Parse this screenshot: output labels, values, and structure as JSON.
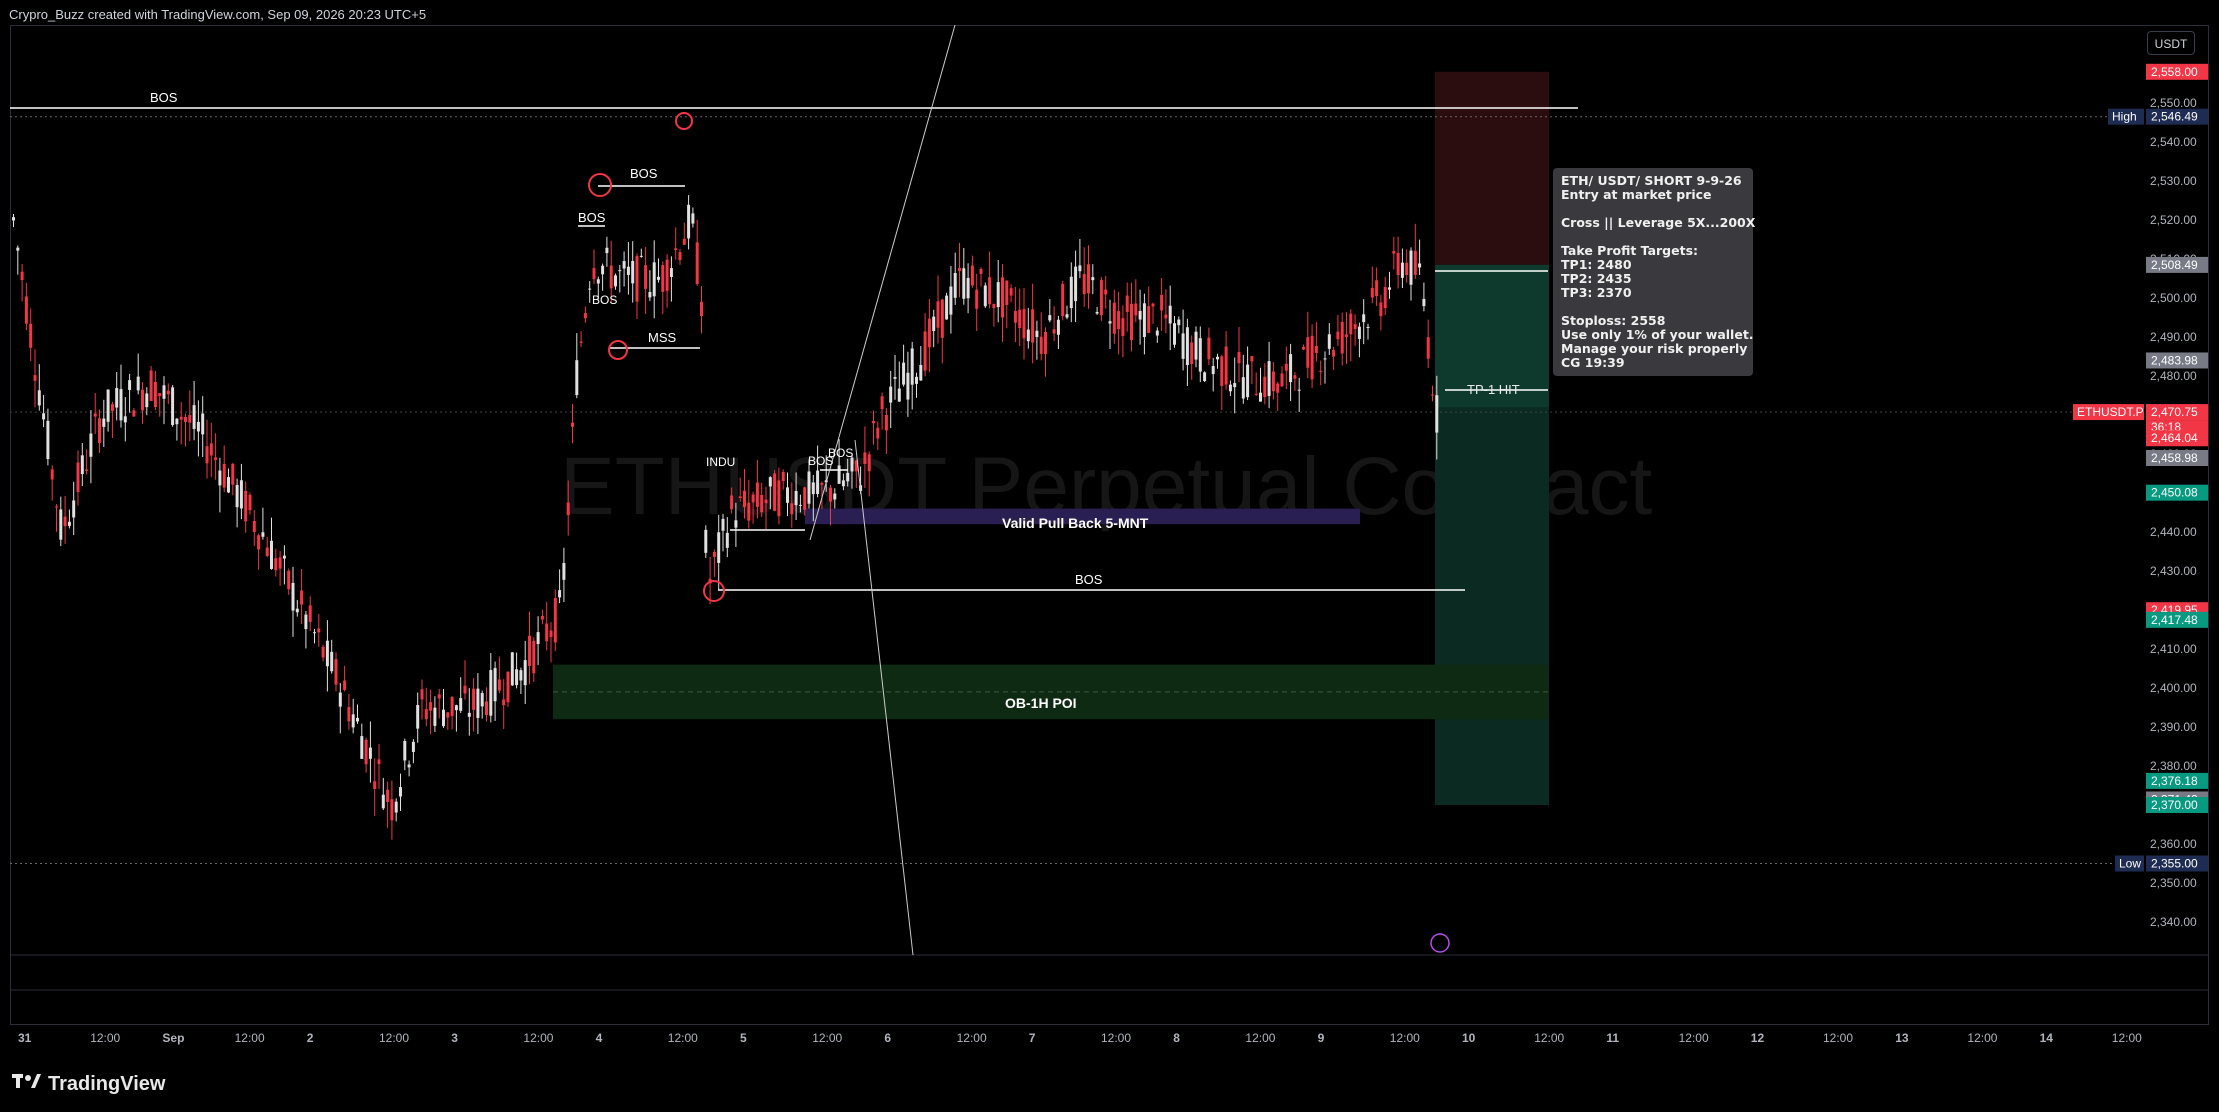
{
  "header": {
    "attribution": "Crypro_Buzz created with TradingView.com, Sep 09, 2026 20:23 UTC+5"
  },
  "watermark": "ETHUSDT Perpetual Contract",
  "currency_button": "USDT",
  "footer": {
    "brand": "TradingView"
  },
  "trade_note": {
    "lines": [
      "ETH/ USDT/ SHORT 9-9-26",
      "Entry at market price",
      "",
      "Cross || Leverage 5X...200X",
      "",
      "Take Profit Targets:",
      "TP1: 2480",
      "TP2: 2435",
      "TP3: 2370",
      "",
      "Stoploss: 2558",
      "Use only 1% of your wallet.",
      "Manage your risk properly",
      "CG 19:39"
    ]
  },
  "annotations": {
    "bos_top": "BOS",
    "bos_2": "BOS",
    "bos_3": "BOS",
    "bos_4": "BOS",
    "mss": "MSS",
    "indu": "INDU",
    "bos_5": "BOS",
    "bos_6": "BOS",
    "pullback": "Valid Pull Back 5-MNT",
    "bos_low": "BOS",
    "ob_poi": "OB-1H POI",
    "tp_hit": "TP-1 HIT"
  },
  "colors": {
    "up": "#e0e0e0",
    "down": "#f23645",
    "green": "#089981",
    "red_zone": "#2b0d10",
    "green_zone": "#0a2a22",
    "ob_zone": "#0f2a12",
    "pullback_zone": "#2a1f52",
    "navy_chip": "#1e2b52"
  },
  "price_axis": {
    "ticks": [
      "2,550.00",
      "2,540.00",
      "2,530.00",
      "2,520.00",
      "2,510.00",
      "2,500.00",
      "2,490.00",
      "2,480.00",
      "2,470.00",
      "2,460.00",
      "2,450.00",
      "2,440.00",
      "2,430.00",
      "2,420.00",
      "2,410.00",
      "2,400.00",
      "2,390.00",
      "2,380.00",
      "2,370.00",
      "2,360.00",
      "2,350.00",
      "2,340.00"
    ],
    "chips": [
      {
        "label": "",
        "value": "2,558.00",
        "kind": "red"
      },
      {
        "label": "High",
        "value": "2,546.49",
        "kind": "navy"
      },
      {
        "label": "",
        "value": "2,508.49",
        "kind": "gray"
      },
      {
        "label": "",
        "value": "2,483.98",
        "kind": "gray"
      },
      {
        "label": "ETHUSDT.P",
        "value": "2,470.75",
        "sub": "36:18",
        "kind": "red"
      },
      {
        "label": "",
        "value": "2,464.04",
        "kind": "red"
      },
      {
        "label": "",
        "value": "2,458.98",
        "kind": "gray"
      },
      {
        "label": "",
        "value": "2,450.08",
        "kind": "green"
      },
      {
        "label": "",
        "value": "2,419.95",
        "kind": "red"
      },
      {
        "label": "",
        "value": "2,417.48",
        "kind": "green"
      },
      {
        "label": "",
        "value": "2,376.18",
        "kind": "green"
      },
      {
        "label": "",
        "value": "2,371.42",
        "kind": "gray"
      },
      {
        "label": "",
        "value": "2,370.00",
        "kind": "green"
      },
      {
        "label": "Low",
        "value": "2,355.00",
        "kind": "navy"
      }
    ]
  },
  "time_axis": [
    "31",
    "12:00",
    "Sep",
    "12:00",
    "2",
    "12:00",
    "3",
    "12:00",
    "4",
    "12:00",
    "5",
    "12:00",
    "6",
    "12:00",
    "7",
    "12:00",
    "8",
    "12:00",
    "9",
    "12:00",
    "10",
    "12:00",
    "11",
    "12:00",
    "12",
    "12:00",
    "13",
    "12:00",
    "14",
    "12:00"
  ],
  "chart_data": {
    "type": "candlestick",
    "symbol": "ETHUSDT.P",
    "ylim": [
      2335,
      2560
    ],
    "last_price": 2470.75,
    "high": 2546.49,
    "low": 2355.0,
    "levels": {
      "stoploss": 2558,
      "entry": 2508.49,
      "tp1": 2480,
      "tp2": 2435,
      "tp3": 2370
    }
  }
}
